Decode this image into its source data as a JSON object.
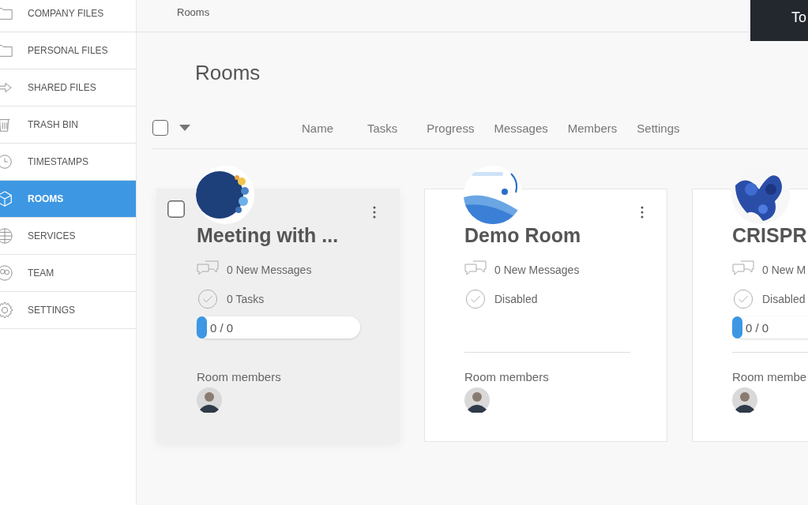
{
  "sidebar": {
    "items": [
      {
        "label": "COMPANY FILES",
        "selected": false
      },
      {
        "label": "PERSONAL FILES",
        "selected": false
      },
      {
        "label": "SHARED FILES",
        "selected": false
      },
      {
        "label": "TRASH BIN",
        "selected": false
      },
      {
        "label": "TIMESTAMPS",
        "selected": false
      },
      {
        "label": "ROOMS",
        "selected": true
      },
      {
        "label": "SERVICES",
        "selected": false
      },
      {
        "label": "TEAM",
        "selected": false
      },
      {
        "label": "SETTINGS",
        "selected": false
      }
    ]
  },
  "breadcrumb": "Rooms",
  "top_button": "To",
  "page_title": "Rooms",
  "list_header": {
    "select_all_checked": false,
    "columns": [
      "Name",
      "Tasks",
      "Progress",
      "Messages",
      "Members",
      "Settings"
    ]
  },
  "rooms": [
    {
      "name": "Meeting with ...",
      "hovered": true,
      "checked": false,
      "messages": "0 New Messages",
      "tasks": "0 Tasks",
      "progress": {
        "level": 0,
        "label": "0 / 0"
      },
      "members_label": "Room members"
    },
    {
      "name": "Demo Room",
      "hovered": false,
      "messages": "0 New Messages",
      "tasks": "Disabled",
      "members_label": "Room members"
    },
    {
      "name": "CRISPR",
      "hovered": false,
      "messages": "0 New M",
      "tasks": "Disabled",
      "progress": {
        "level": 0,
        "label": "0 / 0"
      },
      "members_label": "Room membe"
    }
  ]
}
